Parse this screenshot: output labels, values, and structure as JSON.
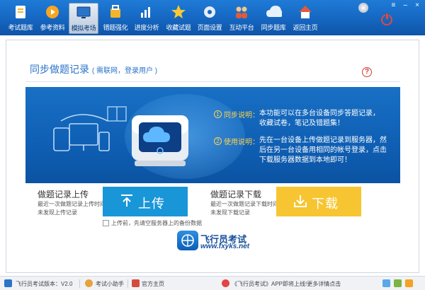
{
  "toolbar": {
    "items": [
      {
        "label": "考试题库",
        "icon": "exam-library-icon"
      },
      {
        "label": "参考资料",
        "icon": "reference-play-icon"
      },
      {
        "label": "模拟考场",
        "icon": "mock-exam-monitor-icon"
      },
      {
        "label": "错题强化",
        "icon": "wrong-questions-bag-icon"
      },
      {
        "label": "进度分析",
        "icon": "progress-chart-icon"
      },
      {
        "label": "收藏试题",
        "icon": "favorite-star-icon"
      },
      {
        "label": "页面设置",
        "icon": "settings-gear-icon"
      },
      {
        "label": "互动平台",
        "icon": "community-people-icon"
      },
      {
        "label": "同步题库",
        "icon": "sync-cloud-icon"
      },
      {
        "label": "返回主页",
        "icon": "home-icon"
      }
    ],
    "active_index": 2,
    "window_controls": {
      "menu": "≡",
      "minimize": "–",
      "close": "×"
    },
    "colors": {
      "bar_top": "#1f7bd6",
      "bar_bottom": "#0f54a8",
      "power": "#e04a3f"
    }
  },
  "panel": {
    "title": "同步做题记录",
    "title_note": "( 需联网，登录用户 )",
    "help_symbol": "?"
  },
  "banner": {
    "items": [
      {
        "num": "1",
        "key": "同步说明：",
        "lines": [
          "本功能可以在多台设备同步答题记录，",
          "收藏试卷，笔记及错题集！"
        ]
      },
      {
        "num": "2",
        "key": "使用说明：",
        "lines": [
          "先在一台设备上传做题记录到服务器，然",
          "后在另一台设备用相同的帐号登录，点击",
          "下载服务器数据到本地即可！"
        ]
      }
    ],
    "colors": {
      "accent": "#ffd24a",
      "background": "#1166bb"
    }
  },
  "upload": {
    "title": "做题记录上传",
    "desc": [
      "最近一次做题记录上传时间",
      "未发现上传记录"
    ],
    "button_label": "上传",
    "backup_label": "上传前，先请空服务器上的备份数据",
    "color": "#1996d8"
  },
  "download": {
    "title": "做题记录下载",
    "desc": [
      "最近一次做题记录下载时间",
      "未发现下载记录"
    ],
    "button_label": "下载",
    "color": "#f7c531"
  },
  "logo": {
    "title": "飞行员考试",
    "url": "www.fxyks.net"
  },
  "statusbar": {
    "version": "飞行员考试版本：V2.0",
    "assistant": "考试小助手",
    "homepage": "官方主页",
    "notice": "《飞行员考试》APP即将上线!更多详情点击"
  }
}
